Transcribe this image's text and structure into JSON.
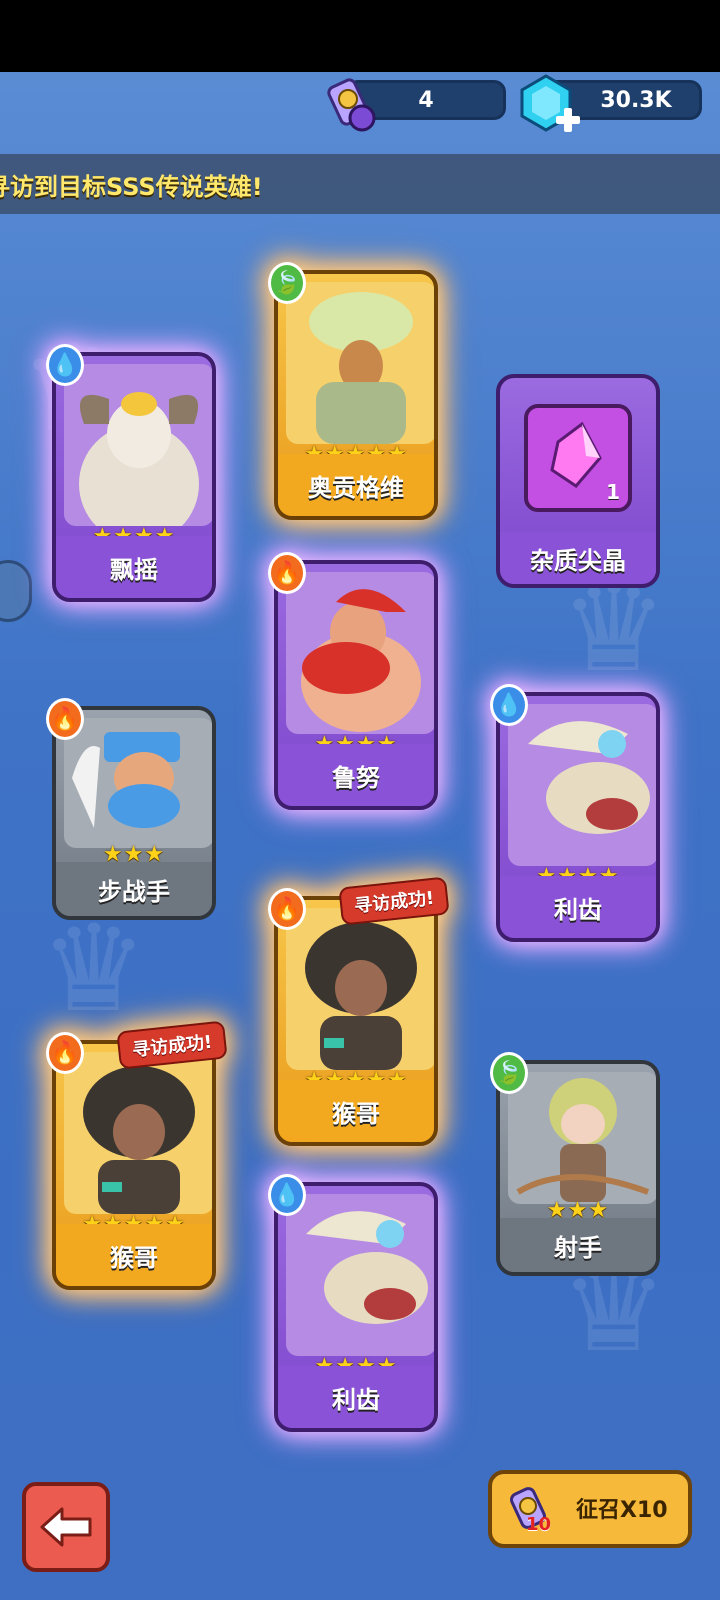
{
  "resources": {
    "scrolls": {
      "icon": "scroll-icon",
      "value": "4"
    },
    "gems": {
      "icon": "gem-icon",
      "value": "30.3K"
    }
  },
  "banner": {
    "text": "寻访到目标SSS传说英雄!"
  },
  "cards": [
    {
      "name": "飘摇",
      "stars": "★★★★",
      "element": "water",
      "rarity": "purple"
    },
    {
      "name": "奥贡格维",
      "stars": "★★★★★",
      "element": "leaf",
      "rarity": "gold"
    },
    {
      "name": "杂质尖晶",
      "count": "1",
      "rarity": "purple"
    },
    {
      "name": "鲁努",
      "stars": "★★★★",
      "element": "fire",
      "rarity": "purple"
    },
    {
      "name": "步战手",
      "stars": "★★★",
      "element": "fire",
      "rarity": "gray"
    },
    {
      "name": "利齿",
      "stars": "★★★★",
      "element": "water",
      "rarity": "purple"
    },
    {
      "name": "猴哥",
      "stars": "★★★★★",
      "element": "fire",
      "rarity": "gold",
      "tag": "寻访成功!"
    },
    {
      "name": "猴哥",
      "stars": "★★★★★",
      "element": "fire",
      "rarity": "gold",
      "tag": "寻访成功!"
    },
    {
      "name": "射手",
      "stars": "★★★",
      "element": "leaf",
      "rarity": "gray"
    },
    {
      "name": "利齿",
      "stars": "★★★★",
      "element": "water",
      "rarity": "purple"
    }
  ],
  "buttons": {
    "back": {
      "icon": "back-arrow-icon"
    },
    "summon": {
      "label": "征召X10",
      "badge": "10",
      "icon": "scroll-icon"
    }
  },
  "colors": {
    "purple": "#8a52d6",
    "gold": "#f2a81f",
    "gray": "#6e7680",
    "star": "#ffd21a"
  }
}
